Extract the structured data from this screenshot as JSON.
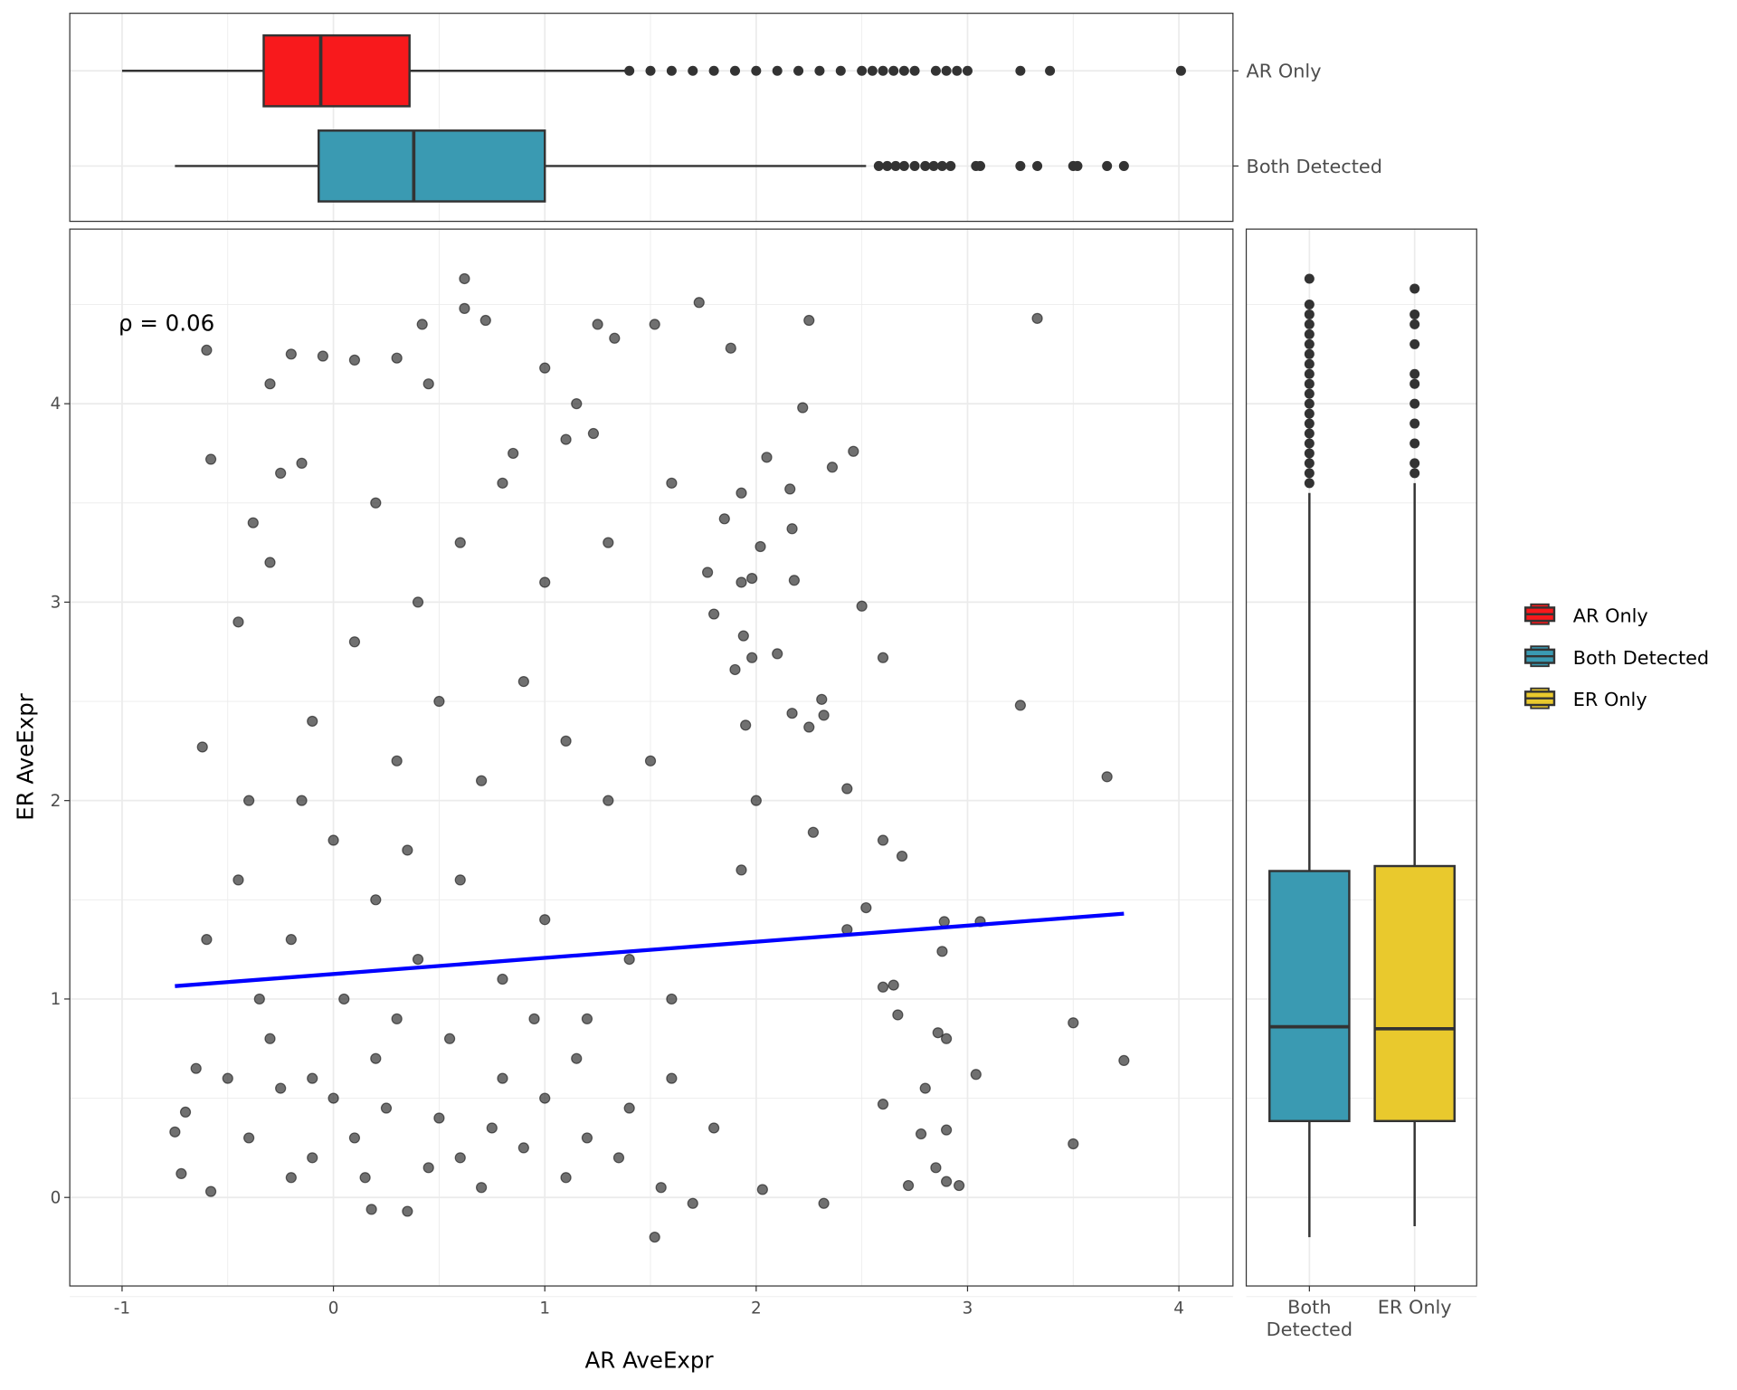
{
  "chart_data": [
    {
      "type": "scatter",
      "xlabel": "AR AveExpr",
      "ylabel": "ER AveExpr",
      "xlim": [
        -1.25,
        4.26
      ],
      "ylim": [
        -0.45,
        4.88
      ],
      "x_ticks": [
        "-1",
        "0",
        "1",
        "2",
        "3",
        "4"
      ],
      "y_ticks": [
        "0",
        "1",
        "2",
        "3",
        "4"
      ],
      "grid": true,
      "annotation": "ρ = 0.06",
      "point_color": "#333333",
      "regression_line": {
        "color": "#0000FF",
        "x": [
          -0.75,
          3.74
        ],
        "y": [
          1.065,
          1.43
        ]
      },
      "points": [
        [
          -0.6,
          4.27
        ],
        [
          -0.58,
          3.72
        ],
        [
          -0.62,
          2.27
        ],
        [
          -0.6,
          1.3
        ],
        [
          -0.65,
          0.65
        ],
        [
          -0.7,
          0.43
        ],
        [
          -0.75,
          0.33
        ],
        [
          -0.72,
          0.12
        ],
        [
          -0.58,
          0.03
        ],
        [
          -0.5,
          0.6
        ],
        [
          -0.45,
          1.6
        ],
        [
          -0.4,
          2.0
        ],
        [
          -0.45,
          2.9
        ],
        [
          -0.38,
          3.4
        ],
        [
          -0.3,
          4.1
        ],
        [
          -0.25,
          3.65
        ],
        [
          -0.2,
          4.25
        ],
        [
          -0.15,
          3.7
        ],
        [
          -0.05,
          4.24
        ],
        [
          0.1,
          4.22
        ],
        [
          0.3,
          4.23
        ],
        [
          0.45,
          4.1
        ],
        [
          0.62,
          4.63
        ],
        [
          0.62,
          4.48
        ],
        [
          0.72,
          4.42
        ],
        [
          0.42,
          4.4
        ],
        [
          1.25,
          4.4
        ],
        [
          1.33,
          4.33
        ],
        [
          1.52,
          4.4
        ],
        [
          1.73,
          4.51
        ],
        [
          1.88,
          4.28
        ],
        [
          2.25,
          4.42
        ],
        [
          3.33,
          4.43
        ],
        [
          1.0,
          4.18
        ],
        [
          1.15,
          4.0
        ],
        [
          0.85,
          3.75
        ],
        [
          1.1,
          3.82
        ],
        [
          1.23,
          3.85
        ],
        [
          2.05,
          3.73
        ],
        [
          2.22,
          3.98
        ],
        [
          2.46,
          3.76
        ],
        [
          2.36,
          3.68
        ],
        [
          2.16,
          3.57
        ],
        [
          1.93,
          3.55
        ],
        [
          1.85,
          3.42
        ],
        [
          2.17,
          3.37
        ],
        [
          2.02,
          3.28
        ],
        [
          2.18,
          3.11
        ],
        [
          1.98,
          3.12
        ],
        [
          1.93,
          3.1
        ],
        [
          2.5,
          2.98
        ],
        [
          1.77,
          3.15
        ],
        [
          1.8,
          2.94
        ],
        [
          1.94,
          2.83
        ],
        [
          2.1,
          2.74
        ],
        [
          1.98,
          2.72
        ],
        [
          2.6,
          2.72
        ],
        [
          1.9,
          2.66
        ],
        [
          3.25,
          2.48
        ],
        [
          2.31,
          2.51
        ],
        [
          2.17,
          2.44
        ],
        [
          2.32,
          2.43
        ],
        [
          2.25,
          2.37
        ],
        [
          1.95,
          2.38
        ],
        [
          3.66,
          2.12
        ],
        [
          2.43,
          2.06
        ],
        [
          2.0,
          2.0
        ],
        [
          1.93,
          1.65
        ],
        [
          2.27,
          1.84
        ],
        [
          2.6,
          1.8
        ],
        [
          2.69,
          1.72
        ],
        [
          2.52,
          1.46
        ],
        [
          2.89,
          1.39
        ],
        [
          3.06,
          1.39
        ],
        [
          2.43,
          1.35
        ],
        [
          2.88,
          1.24
        ],
        [
          2.6,
          1.06
        ],
        [
          2.65,
          1.07
        ],
        [
          2.67,
          0.92
        ],
        [
          3.5,
          0.88
        ],
        [
          2.86,
          0.83
        ],
        [
          2.9,
          0.8
        ],
        [
          3.04,
          0.62
        ],
        [
          3.74,
          0.69
        ],
        [
          2.8,
          0.55
        ],
        [
          2.6,
          0.47
        ],
        [
          2.78,
          0.32
        ],
        [
          2.9,
          0.34
        ],
        [
          3.5,
          0.27
        ],
        [
          2.85,
          0.15
        ],
        [
          2.9,
          0.08
        ],
        [
          2.96,
          0.06
        ],
        [
          2.72,
          0.06
        ],
        [
          2.32,
          -0.03
        ],
        [
          1.52,
          -0.2
        ],
        [
          1.7,
          -0.03
        ],
        [
          2.03,
          0.04
        ],
        [
          0.35,
          -0.07
        ],
        [
          0.18,
          -0.06
        ],
        [
          -0.2,
          0.1
        ],
        [
          0.0,
          0.5
        ],
        [
          0.1,
          0.3
        ],
        [
          0.2,
          0.7
        ],
        [
          -0.1,
          0.6
        ],
        [
          0.3,
          0.9
        ],
        [
          0.5,
          0.4
        ],
        [
          0.6,
          0.2
        ],
        [
          0.8,
          0.6
        ],
        [
          1.0,
          0.5
        ],
        [
          1.2,
          0.3
        ],
        [
          1.4,
          0.45
        ],
        [
          1.6,
          0.6
        ],
        [
          1.8,
          0.35
        ],
        [
          0.4,
          1.2
        ],
        [
          0.2,
          1.5
        ],
        [
          0.0,
          1.8
        ],
        [
          -0.2,
          1.3
        ],
        [
          0.6,
          1.6
        ],
        [
          0.8,
          1.1
        ],
        [
          1.0,
          1.4
        ],
        [
          1.2,
          0.9
        ],
        [
          1.4,
          1.2
        ],
        [
          1.6,
          1.0
        ],
        [
          0.3,
          2.2
        ],
        [
          0.5,
          2.5
        ],
        [
          0.1,
          2.8
        ],
        [
          -0.1,
          2.4
        ],
        [
          0.7,
          2.1
        ],
        [
          0.9,
          2.6
        ],
        [
          1.1,
          2.3
        ],
        [
          1.3,
          2.0
        ],
        [
          1.5,
          2.2
        ],
        [
          0.4,
          3.0
        ],
        [
          0.6,
          3.3
        ],
        [
          0.2,
          3.5
        ],
        [
          -0.3,
          3.2
        ],
        [
          0.8,
          3.6
        ],
        [
          1.0,
          3.1
        ],
        [
          1.3,
          3.3
        ],
        [
          1.6,
          3.6
        ],
        [
          -0.3,
          0.8
        ],
        [
          -0.4,
          0.3
        ],
        [
          -0.1,
          0.2
        ],
        [
          0.15,
          0.1
        ],
        [
          0.45,
          0.15
        ],
        [
          0.7,
          0.05
        ],
        [
          0.9,
          0.25
        ],
        [
          1.1,
          0.1
        ],
        [
          1.35,
          0.2
        ],
        [
          1.55,
          0.05
        ],
        [
          -0.35,
          1.0
        ],
        [
          -0.25,
          0.55
        ],
        [
          0.05,
          1.0
        ],
        [
          0.25,
          0.45
        ],
        [
          0.55,
          0.8
        ],
        [
          0.75,
          0.35
        ],
        [
          0.95,
          0.9
        ],
        [
          1.15,
          0.7
        ],
        [
          -0.15,
          2.0
        ],
        [
          0.35,
          1.75
        ]
      ]
    },
    {
      "type": "boxplot",
      "orientation": "horizontal",
      "position": "top",
      "categories": [
        "AR Only",
        "Both Detected"
      ],
      "series": [
        {
          "name": "AR Only",
          "color": "#F8191C",
          "whisker_low": -1.0,
          "q1": -0.33,
          "median": -0.06,
          "q3": 0.36,
          "whisker_high": 1.38,
          "outliers": [
            1.4,
            1.5,
            1.6,
            1.7,
            1.8,
            1.9,
            2.0,
            2.1,
            2.2,
            2.3,
            2.4,
            2.5,
            2.55,
            2.6,
            2.65,
            2.7,
            2.75,
            2.85,
            2.9,
            2.95,
            3.0,
            3.25,
            3.39,
            4.01
          ]
        },
        {
          "name": "Both Detected",
          "color": "#3A9AB2",
          "whisker_low": -0.75,
          "q1": -0.07,
          "median": 0.38,
          "q3": 1.0,
          "whisker_high": 2.52,
          "outliers": [
            2.58,
            2.62,
            2.66,
            2.7,
            2.75,
            2.8,
            2.84,
            2.88,
            2.92,
            3.04,
            3.06,
            3.25,
            3.33,
            3.5,
            3.52,
            3.66,
            3.74
          ]
        }
      ]
    },
    {
      "type": "boxplot",
      "orientation": "vertical",
      "position": "right",
      "categories": [
        "Both\nDetected",
        "ER Only"
      ],
      "series": [
        {
          "name": "Both Detected",
          "color": "#3A9AB2",
          "whisker_low": -0.2,
          "q1": 0.385,
          "median": 0.86,
          "q3": 1.645,
          "whisker_high": 3.55,
          "outliers": [
            3.6,
            3.65,
            3.7,
            3.75,
            3.8,
            3.85,
            3.9,
            3.95,
            4.0,
            4.05,
            4.1,
            4.15,
            4.2,
            4.25,
            4.3,
            4.35,
            4.4,
            4.45,
            4.5,
            4.63
          ]
        },
        {
          "name": "ER Only",
          "color": "#E9C92D",
          "whisker_low": -0.145,
          "q1": 0.385,
          "median": 0.85,
          "q3": 1.67,
          "whisker_high": 3.6,
          "outliers": [
            3.65,
            3.7,
            3.8,
            3.9,
            4.0,
            4.1,
            4.15,
            4.3,
            4.4,
            4.45,
            4.58
          ]
        }
      ]
    }
  ],
  "legend": {
    "placement": "right",
    "items": [
      {
        "label": "AR Only",
        "color": "#F8191C"
      },
      {
        "label": "Both Detected",
        "color": "#3A9AB2"
      },
      {
        "label": "ER Only",
        "color": "#E9C92D"
      }
    ]
  }
}
